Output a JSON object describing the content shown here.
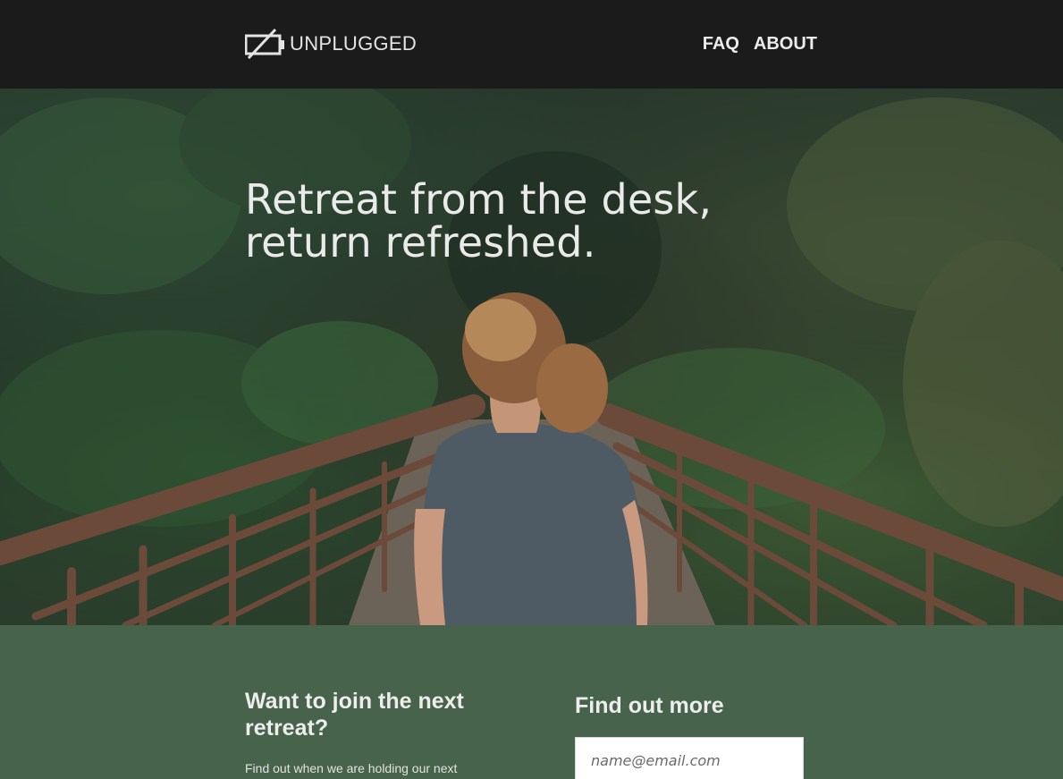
{
  "header": {
    "logo_text": "UNPLUGGED",
    "nav": [
      {
        "label": "FAQ"
      },
      {
        "label": "ABOUT"
      }
    ]
  },
  "hero": {
    "title_line1": "Retreat from the desk,",
    "title_line2": "return refreshed."
  },
  "signup": {
    "join_heading": "Want to join the next retreat?",
    "join_text": "Find out when we are holding our next",
    "more_heading": "Find out more",
    "email_placeholder": "name@email.com"
  },
  "colors": {
    "header_bg": "#1b1b1b",
    "section_bg": "#47634b",
    "text_light": "#eaeaea"
  }
}
